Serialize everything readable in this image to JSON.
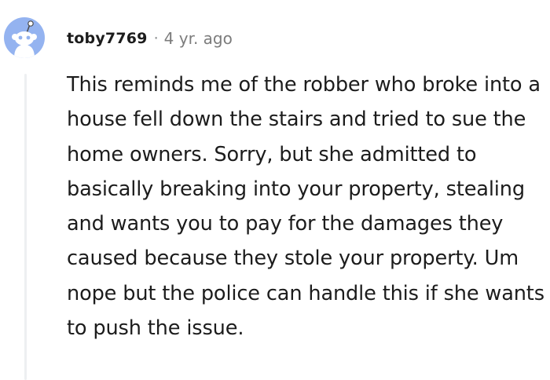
{
  "comment": {
    "author": "toby7769",
    "separator": "·",
    "timestamp": "4 yr. ago",
    "body": "This reminds me of the robber who broke into a house fell down the stairs and tried to sue the home owners. Sorry, but she admitted to basically breaking into your property, stealing and wants you to pay for the damages they caused because they stole your property. Um nope but the police can handle this if she wants to push the issue.",
    "avatar_icon": "snoo-avatar-icon"
  },
  "colors": {
    "avatar_bg": "#94b3f0",
    "text": "#1c1c1c",
    "meta": "#7c7c7c",
    "thread_line": "#edeff1"
  }
}
